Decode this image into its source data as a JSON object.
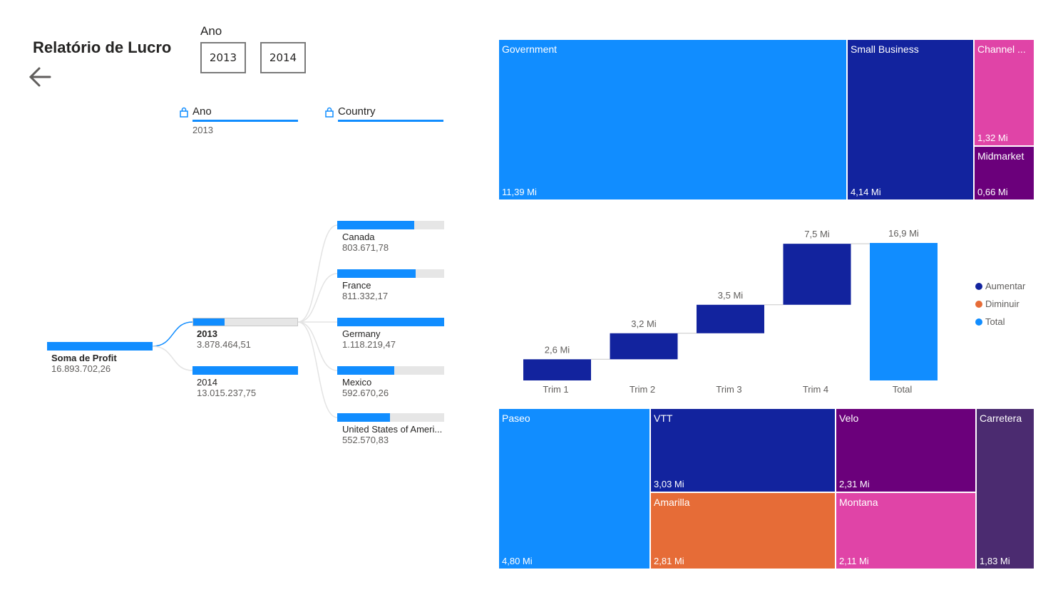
{
  "header": {
    "title": "Relatório de Lucro"
  },
  "slicer": {
    "label": "Ano",
    "options": [
      "2013",
      "2014"
    ]
  },
  "decomposition": {
    "levels": [
      {
        "name": "Ano",
        "selected": "2013"
      },
      {
        "name": "Country",
        "selected": ""
      }
    ],
    "root": {
      "name": "Soma de Profit",
      "value": "16.893.702,26"
    },
    "years": [
      {
        "name": "2013",
        "value": "3.878.464,51",
        "fraction": 0.3
      },
      {
        "name": "2014",
        "value": "13.015.237,75",
        "fraction": 1.0
      }
    ],
    "countries": [
      {
        "name": "Canada",
        "value": "803.671,78",
        "fraction": 0.72
      },
      {
        "name": "France",
        "value": "811.332,17",
        "fraction": 0.73
      },
      {
        "name": "Germany",
        "value": "1.118.219,47",
        "fraction": 1.0
      },
      {
        "name": "Mexico",
        "value": "592.670,26",
        "fraction": 0.53
      },
      {
        "name": "United States of Ameri...",
        "value": "552.570,83",
        "fraction": 0.49
      }
    ]
  },
  "colors": {
    "light_blue": "#118dff",
    "dark_blue": "#12239e",
    "pink": "#e044a7",
    "purple": "#6b007b",
    "orange": "#e66c37",
    "dark_purple": "#4b2b70",
    "gray": "#e6e6e6"
  },
  "chart_data": [
    {
      "type": "treemap",
      "items": [
        {
          "name": "Government",
          "label": "11,39 Mi",
          "value": 11.39
        },
        {
          "name": "Small Business",
          "label": "4,14 Mi",
          "value": 4.14
        },
        {
          "name": "Channel ...",
          "label": "1,32 Mi",
          "value": 1.32
        },
        {
          "name": "Midmarket",
          "label": "0,66 Mi",
          "value": 0.66
        }
      ]
    },
    {
      "type": "waterfall",
      "categories": [
        "Trim 1",
        "Trim 2",
        "Trim 3",
        "Trim 4",
        "Total"
      ],
      "values": [
        2.6,
        3.2,
        3.5,
        7.5,
        16.9
      ],
      "labels": [
        "2,6 Mi",
        "3,2 Mi",
        "3,5 Mi",
        "7,5 Mi",
        "16,9 Mi"
      ],
      "kinds": [
        "Aumentar",
        "Aumentar",
        "Aumentar",
        "Aumentar",
        "Total"
      ],
      "legend": [
        {
          "name": "Aumentar",
          "color": "#12239e"
        },
        {
          "name": "Diminuir",
          "color": "#e66c37"
        },
        {
          "name": "Total",
          "color": "#118dff"
        }
      ]
    },
    {
      "type": "treemap",
      "items": [
        {
          "name": "Paseo",
          "label": "4,80 Mi",
          "value": 4.8
        },
        {
          "name": "VTT",
          "label": "3,03 Mi",
          "value": 3.03
        },
        {
          "name": "Amarilla",
          "label": "2,81 Mi",
          "value": 2.81
        },
        {
          "name": "Velo",
          "label": "2,31 Mi",
          "value": 2.31
        },
        {
          "name": "Montana",
          "label": "2,11 Mi",
          "value": 2.11
        },
        {
          "name": "Carretera",
          "label": "1,83 Mi",
          "value": 1.83
        }
      ]
    }
  ]
}
